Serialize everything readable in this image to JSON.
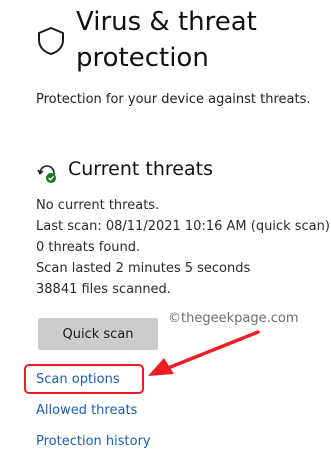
{
  "header": {
    "icon": "shield-icon",
    "title_line1": "Virus & threat",
    "title_line2": "protection",
    "subtitle": "Protection for your device against threats."
  },
  "current_threats": {
    "icon": "refresh-check-icon",
    "title": "Current threats",
    "lines": [
      "No current threats.",
      "Last scan: 08/11/2021 10:16 AM (quick scan)",
      "0 threats found.",
      "Scan lasted 2 minutes 5 seconds",
      "38841 files scanned."
    ],
    "quick_scan_label": "Quick scan"
  },
  "links": {
    "scan_options": "Scan options",
    "allowed_threats": "Allowed threats",
    "protection_history": "Protection history"
  },
  "watermark": "©thegeekpage.com",
  "colors": {
    "link": "#1a5fb4",
    "annotation": "#ee1c25",
    "button_bg": "#cccccc"
  }
}
